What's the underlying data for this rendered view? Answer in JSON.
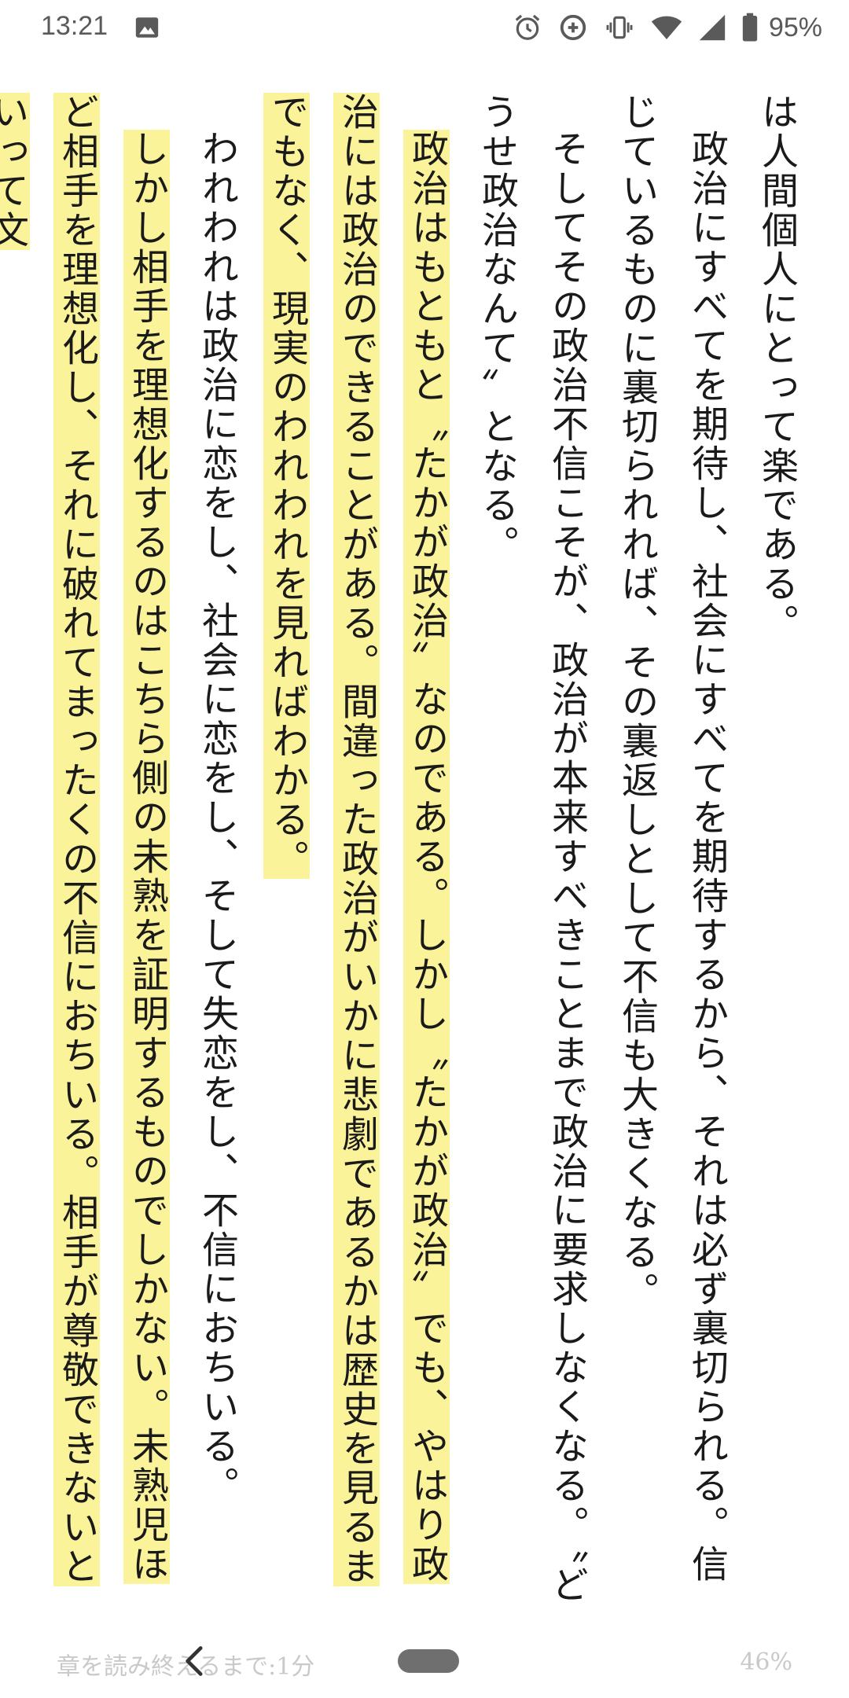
{
  "status_bar": {
    "time": "13:21",
    "battery_percent": "95%",
    "icons": [
      "image-icon",
      "alarm-icon",
      "data-saver-icon",
      "vibrate-icon",
      "wifi-icon",
      "cell-signal-icon",
      "battery-icon"
    ]
  },
  "reader": {
    "paragraphs": [
      {
        "no_indent": true,
        "parts": [
          {
            "text": "は人間個人にとって楽である。",
            "highlight": false
          }
        ]
      },
      {
        "parts": [
          {
            "text": "政治にすべてを期待し、社会にすべてを期待するから、それは必ず裏切られる。信じているものに裏切られれば、その裏返しとして不信も大きくなる。",
            "highlight": false
          }
        ]
      },
      {
        "parts": [
          {
            "text": "そしてその政治不信こそが、政治が本来すべきことまで政治に要求しなくなる。〝どうせ政治なんて〟となる。",
            "highlight": false
          }
        ]
      },
      {
        "parts": [
          {
            "text": "政治はもともと〝たかが政治〟なのである。しかし〝たかが政治〟でも、やはり政治には政治のできることがある。間違った政治がいかに悲劇であるかは歴史を見るまでもなく、現実のわれわれを見ればわかる。",
            "highlight": true
          }
        ]
      },
      {
        "parts": [
          {
            "text": "われわれは政治に恋をし、社会に恋をし、そして失恋をし、不信におちいる。",
            "highlight": false
          }
        ]
      },
      {
        "parts": [
          {
            "text": "しかし相手を理想化するのはこちら側の未熟を証明するものでしかない。未熟児ほど相手を理想化し、それに破れてまったくの不信におちいる。相手が尊敬できないといって文",
            "highlight": true
          }
        ]
      }
    ]
  },
  "footer": {
    "chapter_time_label": "章を読み終えるまで:1分",
    "progress_percent": "46%"
  },
  "colors": {
    "highlight": "#fbf39a",
    "text": "#1a1a1a",
    "status": "#5a5a5a",
    "footer_text": "#c9c9c9"
  }
}
